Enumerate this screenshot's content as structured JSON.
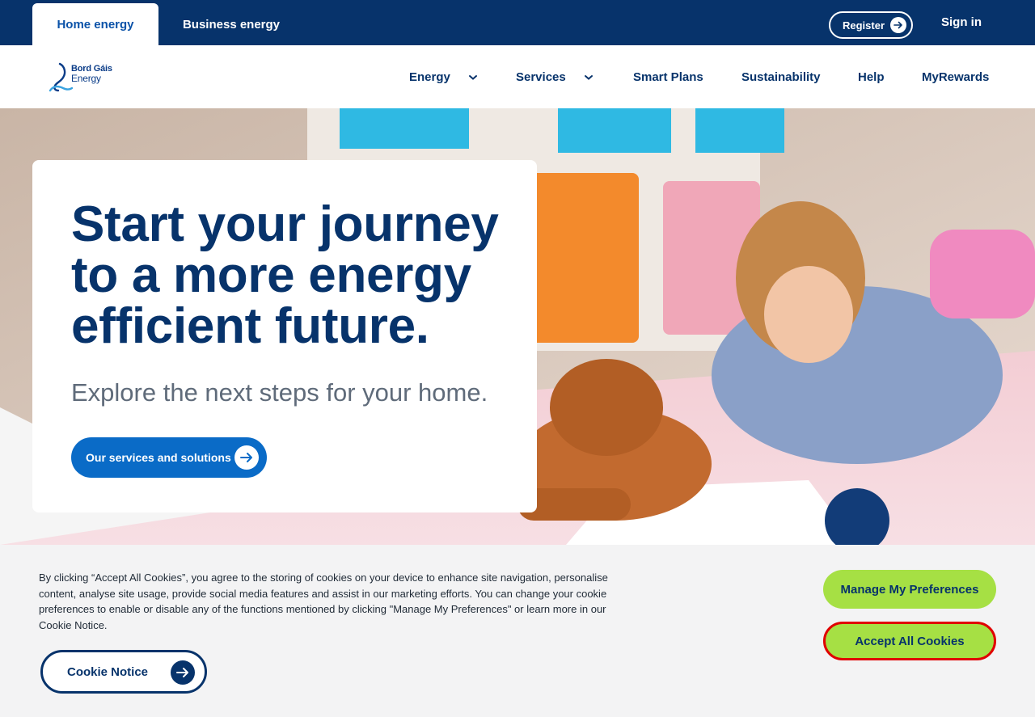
{
  "topbar": {
    "home_tab": "Home energy",
    "business_tab": "Business energy",
    "register": "Register",
    "sign_in": "Sign in"
  },
  "logo": {
    "line1": "Bord Gáis",
    "line2": "Energy"
  },
  "nav": {
    "items": [
      {
        "label": "Energy",
        "dropdown": true
      },
      {
        "label": "Services",
        "dropdown": true
      },
      {
        "label": "Smart Plans",
        "dropdown": false
      },
      {
        "label": "Sustainability",
        "dropdown": false
      },
      {
        "label": "Help",
        "dropdown": false
      },
      {
        "label": "MyRewards",
        "dropdown": false
      }
    ]
  },
  "hero": {
    "headline": "Start your journey to a more energy efficient future.",
    "subheading": "Explore the next steps for your home.",
    "cta": "Our services and solutions"
  },
  "cookie": {
    "text": "By clicking “Accept All Cookies”, you agree to the storing of cookies on your device to enhance site navigation, personalise content, analyse site usage, provide social media features and assist in our marketing efforts. You can change your cookie preferences to enable or disable any of the functions mentioned by clicking \"Manage My Preferences\" or learn more in our Cookie Notice.",
    "notice_button": "Cookie Notice",
    "manage_button": "Manage My Preferences",
    "accept_button": "Accept All Cookies"
  },
  "colors": {
    "brand_navy": "#07336b",
    "brand_blue": "#0a6bc7",
    "accent_green": "#a6e044",
    "focus_red": "#e00000"
  },
  "icons": [
    "arrow-right-icon",
    "chevron-down-icon",
    "logo-flame-icon"
  ]
}
